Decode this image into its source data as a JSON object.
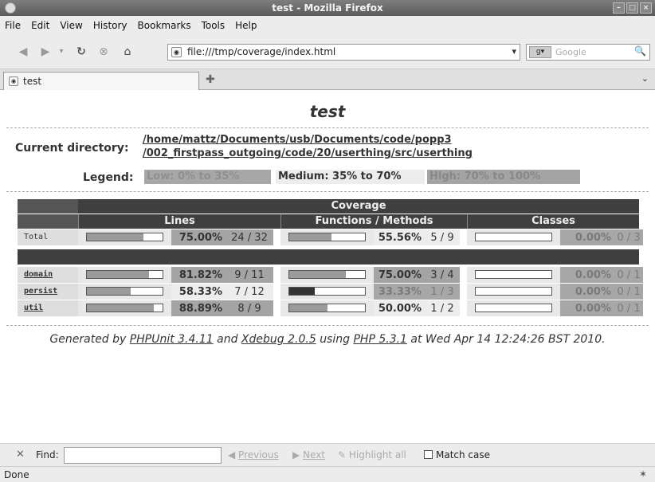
{
  "window": {
    "title": "test - Mozilla Firefox"
  },
  "menu": [
    "File",
    "Edit",
    "View",
    "History",
    "Bookmarks",
    "Tools",
    "Help"
  ],
  "nav": {
    "url": "file:///tmp/coverage/index.html",
    "search_placeholder": "Google"
  },
  "tabs": [
    {
      "label": "test"
    }
  ],
  "page": {
    "title": "test",
    "current_directory_label": "Current directory:",
    "current_directory_line1": "/home/mattz/Documents/usb/Documents/code/popp3",
    "current_directory_line2": "/002_firstpass_outgoing/code/20/userthing/src/userthing",
    "legend_label": "Legend:",
    "legend_low": "Low: 0% to 35%",
    "legend_medium": "Medium: 35% to 70%",
    "legend_high": "High: 70% to 100%",
    "table": {
      "header": "Coverage",
      "col_lines": "Lines",
      "col_functions": "Functions / Methods",
      "col_classes": "Classes",
      "total": {
        "name": "Total",
        "lines_pct": "75.00%",
        "lines_cnt": "24 / 32",
        "lines_frac": 0.75,
        "func_pct": "55.56%",
        "func_cnt": "5 / 9",
        "func_frac": 0.5556,
        "cls_pct": "0.00%",
        "cls_cnt": "0 / 3",
        "cls_frac": 0
      },
      "rows": [
        {
          "name": "domain",
          "lines_pct": "81.82%",
          "lines_cnt": "9 / 11",
          "lines_frac": 0.8182,
          "func_pct": "75.00%",
          "func_cnt": "3 / 4",
          "func_frac": 0.75,
          "cls_pct": "0.00%",
          "cls_cnt": "0 / 1",
          "cls_frac": 0
        },
        {
          "name": "persist",
          "lines_pct": "58.33%",
          "lines_cnt": "7 / 12",
          "lines_frac": 0.5833,
          "func_pct": "33.33%",
          "func_cnt": "1 / 3",
          "func_frac": 0.3333,
          "cls_pct": "0.00%",
          "cls_cnt": "0 / 1",
          "cls_frac": 0
        },
        {
          "name": "util",
          "lines_pct": "88.89%",
          "lines_cnt": "8 / 9",
          "lines_frac": 0.8889,
          "func_pct": "50.00%",
          "func_cnt": "1 / 2",
          "func_frac": 0.5,
          "cls_pct": "0.00%",
          "cls_cnt": "0 / 1",
          "cls_frac": 0
        }
      ]
    },
    "footer": {
      "generated_by": "Generated by",
      "phpunit": "PHPUnit 3.4.11",
      "and": "and",
      "xdebug": "Xdebug 2.0.5",
      "using": "using",
      "php": "PHP 5.3.1",
      "at": "at Wed Apr 14 12:24:26 BST 2010."
    }
  },
  "findbar": {
    "label": "Find:",
    "previous": "Previous",
    "next": "Next",
    "highlight": "Highlight all",
    "match_case": "Match case"
  },
  "status": {
    "text": "Done"
  },
  "colors": {
    "low": "#a7a7a7",
    "medium": "#ededed",
    "high": "#a4a4a4",
    "header": "#3f3f3f"
  }
}
